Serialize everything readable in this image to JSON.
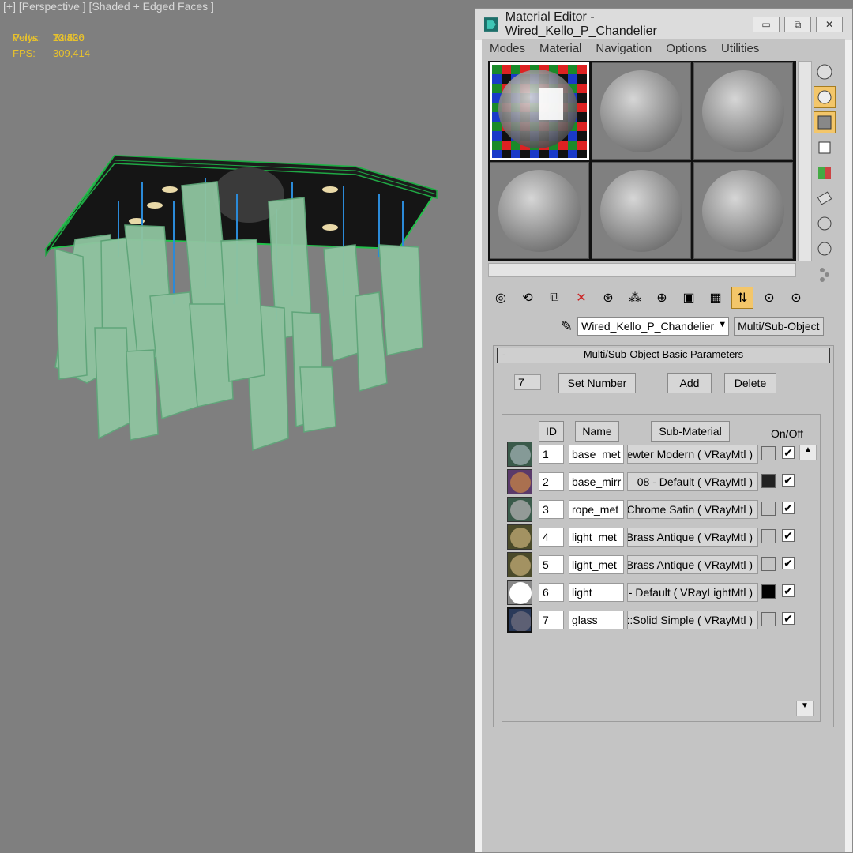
{
  "viewport": {
    "label": "[+] [Perspective ] [Shaded + Edged Faces ]",
    "stats_header": "Total",
    "polys_label": "Polys:",
    "polys_value": "23 526",
    "verts_label": "Verts:",
    "verts_value": "22 430",
    "fps_label": "FPS:",
    "fps_value": "309,414"
  },
  "window": {
    "title": "Material Editor - Wired_Kello_P_Chandelier",
    "minimize": "▭",
    "maximize": "⧉",
    "close": "✕"
  },
  "menu": [
    "Modes",
    "Material",
    "Navigation",
    "Options",
    "Utilities"
  ],
  "material": {
    "name": "Wired_Kello_P_Chandelier",
    "type_button": "Multi/Sub-Object"
  },
  "rollout": {
    "title": "Multi/Sub-Object Basic Parameters",
    "collapse": "-",
    "count": "7",
    "set_number": "Set Number",
    "add": "Add",
    "delete": "Delete",
    "col_id": "ID",
    "col_name": "Name",
    "col_sub": "Sub-Material",
    "col_onoff": "On/Off"
  },
  "rows": [
    {
      "id": "1",
      "name": "base_met",
      "sub": "ewter Modern  ( VRayMtl )",
      "swatch": "#ffffff00"
    },
    {
      "id": "2",
      "name": "base_mirr",
      "sub": "08 - Default  ( VRayMtl )",
      "swatch": "#222222"
    },
    {
      "id": "3",
      "name": "rope_met",
      "sub": "Chrome Satin  ( VRayMtl )",
      "swatch": "#ffffff00"
    },
    {
      "id": "4",
      "name": "light_met",
      "sub": "Brass Antique  ( VRayMtl )",
      "swatch": "#ffffff00"
    },
    {
      "id": "5",
      "name": "light_met",
      "sub": "Brass Antique  ( VRayMtl )",
      "swatch": "#ffffff00"
    },
    {
      "id": "6",
      "name": "light",
      "sub": "- Default  ( VRayLightMtl )",
      "swatch": "#000000"
    },
    {
      "id": "7",
      "name": "glass",
      "sub": "t::Solid Simple  ( VRayMtl )",
      "swatch": "#ffffff00"
    }
  ],
  "colors": {
    "viewport_bg": "#7f7f7f",
    "stats_text": "#e8c22c",
    "mesh_green": "#8fc4a0",
    "active_tool": "#f3c66a"
  }
}
